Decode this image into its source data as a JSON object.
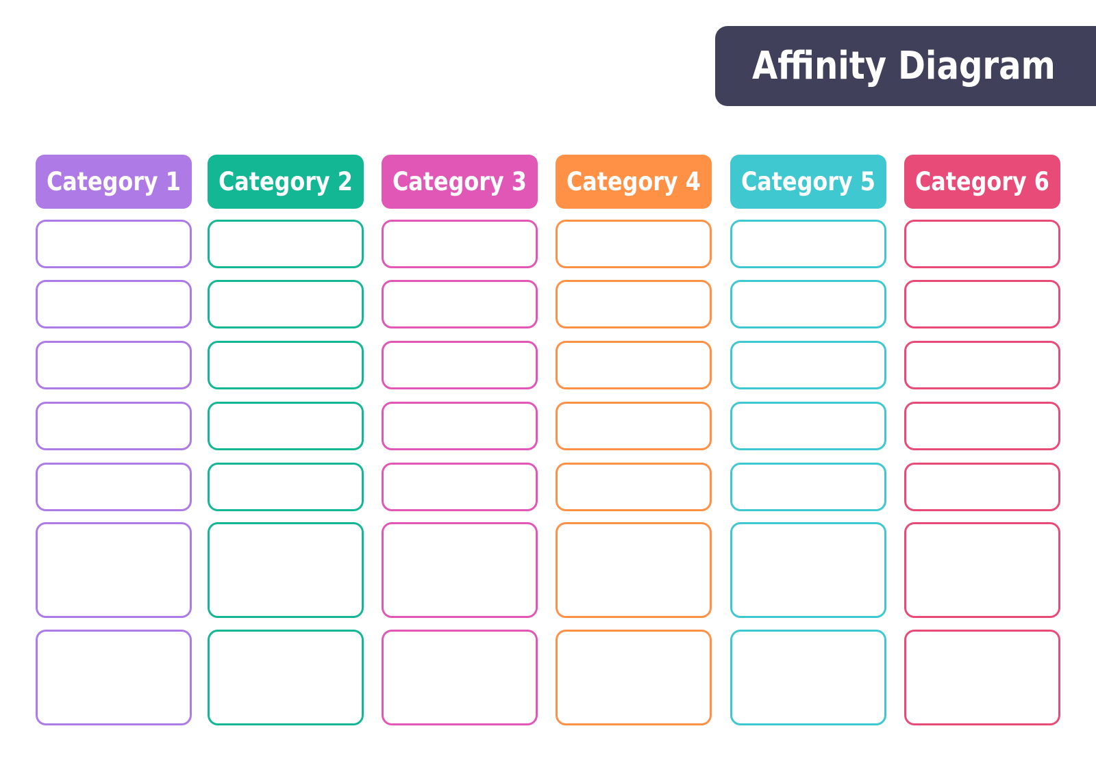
{
  "title": "Affinity Diagram",
  "colors": {
    "title_background": "#41405a",
    "title_text": "#ffffff",
    "header_text": "#ffffff"
  },
  "categories": [
    {
      "label": "Category 1",
      "color": "#ae7be6",
      "cards": [
        "",
        "",
        "",
        "",
        "",
        "",
        ""
      ]
    },
    {
      "label": "Category 2",
      "color": "#13b794",
      "cards": [
        "",
        "",
        "",
        "",
        "",
        "",
        ""
      ]
    },
    {
      "label": "Category 3",
      "color": "#e157b6",
      "cards": [
        "",
        "",
        "",
        "",
        "",
        "",
        ""
      ]
    },
    {
      "label": "Category 4",
      "color": "#ff9146",
      "cards": [
        "",
        "",
        "",
        "",
        "",
        "",
        ""
      ]
    },
    {
      "label": "Category 5",
      "color": "#3fc8d0",
      "cards": [
        "",
        "",
        "",
        "",
        "",
        "",
        ""
      ]
    },
    {
      "label": "Category 6",
      "color": "#e94b78",
      "cards": [
        "",
        "",
        "",
        "",
        "",
        "",
        ""
      ]
    }
  ]
}
